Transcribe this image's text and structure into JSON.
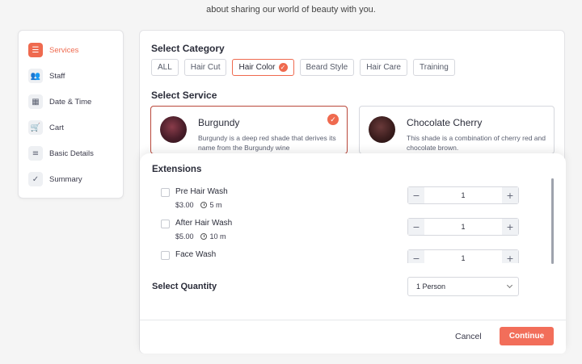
{
  "intro_text": "about sharing our world of beauty with you.",
  "sidebar": {
    "items": [
      {
        "label": "Services",
        "icon": "list-icon",
        "active": true
      },
      {
        "label": "Staff",
        "icon": "people-icon"
      },
      {
        "label": "Date & Time",
        "icon": "calendar-icon"
      },
      {
        "label": "Cart",
        "icon": "cart-icon"
      },
      {
        "label": "Basic Details",
        "icon": "document-icon"
      },
      {
        "label": "Summary",
        "icon": "clipboard-check-icon"
      }
    ]
  },
  "category": {
    "title": "Select Category",
    "chips": [
      {
        "label": "ALL"
      },
      {
        "label": "Hair Cut"
      },
      {
        "label": "Hair Color",
        "active": true
      },
      {
        "label": "Beard Style"
      },
      {
        "label": "Hair Care"
      },
      {
        "label": "Training"
      }
    ]
  },
  "service": {
    "title": "Select Service",
    "cards": [
      {
        "name": "Burgundy",
        "description": "Burgundy is a deep red shade that derives its name from the Burgundy wine",
        "selected": true
      },
      {
        "name": "Chocolate Cherry",
        "description": "This shade is a combination of cherry red and chocolate brown."
      }
    ]
  },
  "extensions": {
    "title": "Extensions",
    "items": [
      {
        "name": "Pre Hair Wash",
        "price": "$3.00",
        "duration": "5 m",
        "quantity": "1"
      },
      {
        "name": "After Hair Wash",
        "price": "$5.00",
        "duration": "10 m",
        "quantity": "1"
      },
      {
        "name": "Face Wash",
        "price": "",
        "duration": "",
        "quantity": "1"
      }
    ],
    "minus": "−",
    "plus": "+"
  },
  "quantity": {
    "label": "Select Quantity",
    "selected": "1 Person"
  },
  "footer": {
    "cancel": "Cancel",
    "continue": "Continue"
  },
  "colors": {
    "accent": "#ef6a4f",
    "selected_border": "#b9473a",
    "continue_bg": "#f26e5a"
  }
}
